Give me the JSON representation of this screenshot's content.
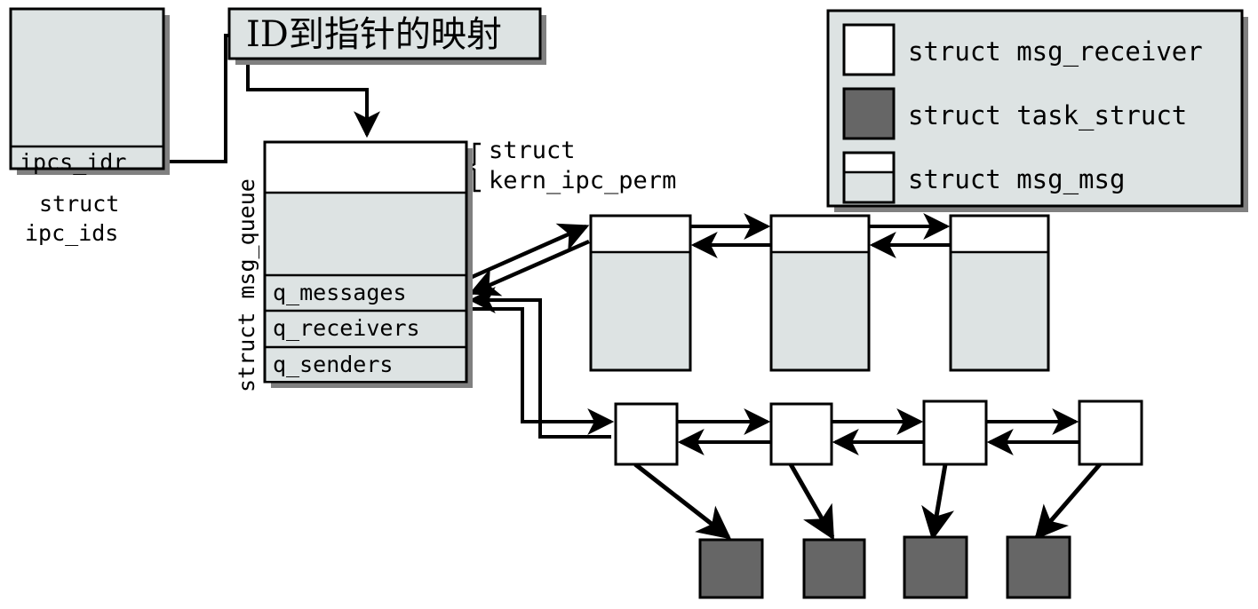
{
  "diagram": {
    "title_note": "Linux IPC message queue structure diagram",
    "colors": {
      "box_fill_gray": "#dde3e3",
      "box_fill_white": "#ffffff",
      "task_struct_fill": "#666666",
      "stroke": "#000000",
      "shadow": "#808080",
      "background": "#ffffff"
    }
  },
  "ipc_ids": {
    "field_label": "ipcs_idr",
    "caption_line1": "struct",
    "caption_line2": "ipc_ids"
  },
  "mapping_box": {
    "label": "ID到指针的映射"
  },
  "msg_queue": {
    "side_label": "struct msg_queue",
    "brace_label_line1": "struct",
    "brace_label_line2": "kern_ipc_perm",
    "fields": [
      {
        "name": "q_messages"
      },
      {
        "name": "q_receivers"
      },
      {
        "name": "q_senders"
      }
    ]
  },
  "legend": {
    "items": [
      {
        "swatch": "msg-receiver-swatch",
        "label": "struct msg_receiver"
      },
      {
        "swatch": "task-struct-swatch",
        "label": "struct task_struct"
      },
      {
        "swatch": "msg-msg-swatch",
        "label": "struct msg_msg"
      }
    ]
  },
  "chains": {
    "msg_msg_count": 3,
    "msg_receiver_count": 4,
    "task_struct_count": 4
  }
}
